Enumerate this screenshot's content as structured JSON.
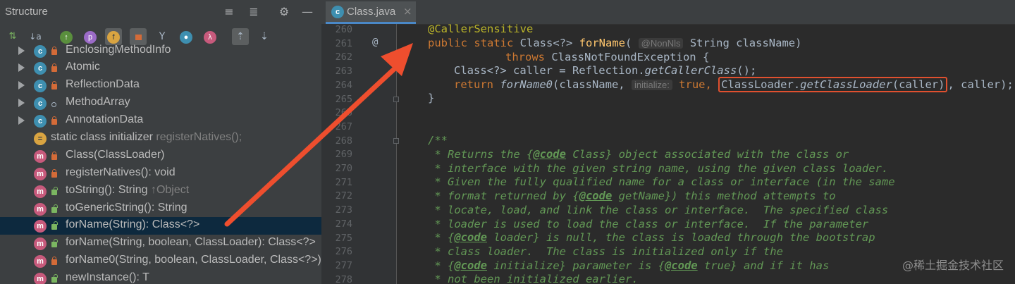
{
  "structure": {
    "title": "Structure",
    "toolbar": [
      {
        "name": "sort-by-type-icon",
        "glyph": "⇅"
      },
      {
        "name": "sort-alpha-icon",
        "glyph": "↓a"
      },
      {
        "name": "show-inherited-icon",
        "glyph": "↑"
      },
      {
        "name": "show-properties-icon",
        "glyph": "p"
      },
      {
        "name": "show-fields-icon",
        "glyph": "f"
      },
      {
        "name": "show-non-public-icon",
        "glyph": "■"
      },
      {
        "name": "show-lambdas-icon",
        "glyph": "Y"
      },
      {
        "name": "show-anonymous-icon",
        "glyph": "●"
      },
      {
        "name": "show-lambda-icon",
        "glyph": "λ"
      },
      {
        "name": "autoscroll-to-source-icon",
        "glyph": "⇡"
      },
      {
        "name": "autoscroll-from-source-icon",
        "glyph": "⇣"
      }
    ],
    "items": [
      {
        "label": "EnclosingMethodInfo",
        "suffix": ""
      },
      {
        "label": "Atomic",
        "suffix": ""
      },
      {
        "label": "ReflectionData",
        "suffix": ""
      },
      {
        "label": "MethodArray",
        "suffix": ""
      },
      {
        "label": "AnnotationData",
        "suffix": ""
      },
      {
        "label": "static class initializer",
        "suffix": "registerNatives();"
      },
      {
        "label": "Class(ClassLoader)",
        "suffix": ""
      },
      {
        "label": "registerNatives(): void",
        "suffix": ""
      },
      {
        "label": "toString(): String",
        "suffix": "↑Object"
      },
      {
        "label": "toGenericString(): String",
        "suffix": ""
      },
      {
        "label": "forName(String): Class<?>",
        "suffix": ""
      },
      {
        "label": "forName(String, boolean, ClassLoader): Class<?>",
        "suffix": ""
      },
      {
        "label": "forName0(String, boolean, ClassLoader, Class<?>)",
        "suffix": ""
      },
      {
        "label": "newInstance(): T",
        "suffix": ""
      }
    ]
  },
  "editor": {
    "tab": {
      "label": "Class.java",
      "icon": "class-file-icon"
    },
    "gutter_annotation": "@",
    "lines": [
      "260",
      "261",
      "262",
      "263",
      "264",
      "265",
      "266",
      "267",
      "268",
      "269",
      "270",
      "271",
      "272",
      "273",
      "274",
      "275",
      "276",
      "277",
      "278"
    ],
    "code": {
      "l260_ann": "@CallerSensitive",
      "l261_kw": "public static ",
      "l261_type": "Class<?> ",
      "l261_fn": "forName",
      "l261_open": "( ",
      "l261_hint": "@NonNls",
      "l261_rest": " String className)",
      "l262_kw": "throws ",
      "l262_rest": "ClassNotFoundException {",
      "l263_a": "Class<?> caller = Reflection.",
      "l263_b": "getCallerClass",
      "l263_c": "();",
      "l264_kw": "return ",
      "l264_fn": "forName0",
      "l264_a": "(className, ",
      "l264_hint": "initialize:",
      "l264_true": "true",
      "l264_comma": ", ",
      "l264_box_a": "ClassLoader.",
      "l264_box_b": "getClassLoader",
      "l264_box_c": "(caller)",
      "l264_end": ", caller);",
      "l265": "}",
      "doc_open": "/**",
      "doc_lines": [
        [
          {
            "t": " * Returns the {"
          },
          {
            "t": "@code",
            "tag": true
          },
          {
            "t": " Class} object associated with the class or"
          }
        ],
        [
          {
            "t": " * interface with the given string name, using the given class loader."
          }
        ],
        [
          {
            "t": " * Given the fully qualified name for a class or interface (in the same"
          }
        ],
        [
          {
            "t": " * format returned by {"
          },
          {
            "t": "@code",
            "tag": true
          },
          {
            "t": " getName}) this method attempts to"
          }
        ],
        [
          {
            "t": " * locate, load, and link the class or interface.  The specified class"
          }
        ],
        [
          {
            "t": " * loader is used to load the class or interface.  If the parameter"
          }
        ],
        [
          {
            "t": " * {"
          },
          {
            "t": "@code",
            "tag": true
          },
          {
            "t": " loader} is null, the class is loaded through the bootstrap"
          }
        ],
        [
          {
            "t": " * class loader.  The class is initialized only if the"
          }
        ],
        [
          {
            "t": " * {"
          },
          {
            "t": "@code",
            "tag": true
          },
          {
            "t": " initialize} parameter is {"
          },
          {
            "t": "@code",
            "tag": true
          },
          {
            "t": " true} and if it has"
          }
        ],
        [
          {
            "t": " * not been initialized earlier."
          }
        ]
      ]
    }
  },
  "watermark": "@稀土掘金技术社区",
  "colors": {
    "arrow": "#ee4e2e",
    "box": "#e0502f",
    "selection": "#0d293e"
  }
}
